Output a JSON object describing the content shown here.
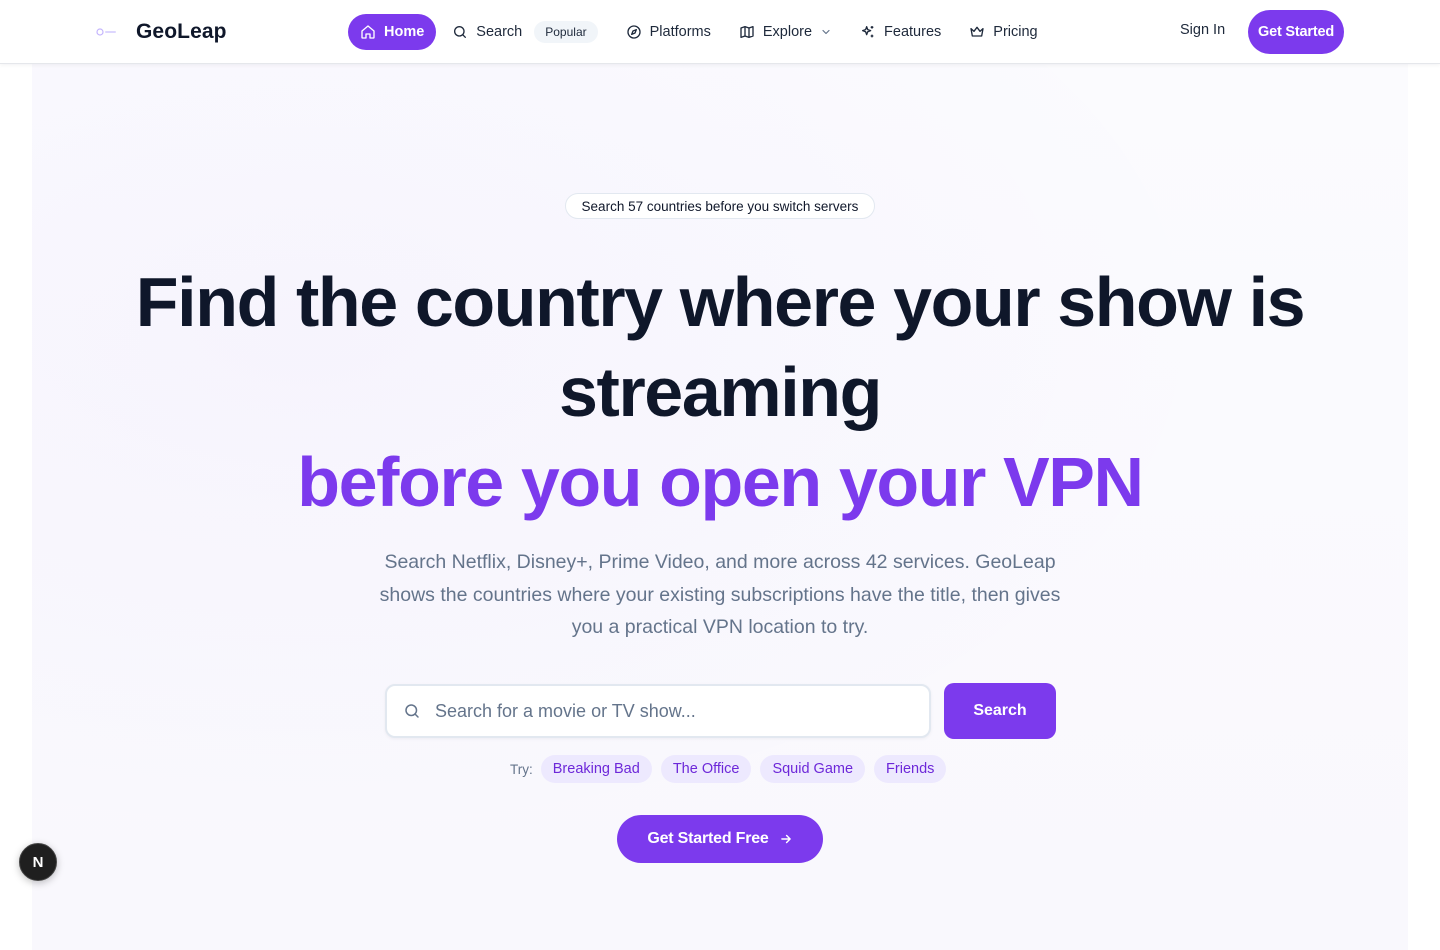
{
  "brand": {
    "name": "GeoLeap",
    "accent": "#7c3aed"
  },
  "nav": {
    "items": [
      {
        "label": "Home",
        "icon": "home-icon",
        "active": true
      },
      {
        "label": "Search",
        "icon": "search-icon",
        "badge": "Popular"
      },
      {
        "label": "Platforms",
        "icon": "compass-icon"
      },
      {
        "label": "Explore",
        "icon": "map-icon",
        "dropdown": true
      },
      {
        "label": "Features",
        "icon": "sparkles-icon"
      },
      {
        "label": "Pricing",
        "icon": "crown-icon"
      }
    ],
    "sign_in": "Sign In",
    "get_started": "Get Started"
  },
  "hero": {
    "pill": "Search 57 countries before you switch servers",
    "headline_line1": "Find the country where your show is",
    "headline_line2": "streaming",
    "headline_accent": "before you open your VPN",
    "lead": "Search Netflix, Disney+, Prime Video, and more across 42 services. GeoLeap shows the countries where your existing subscriptions have the title, then gives you a practical VPN location to try.",
    "search_placeholder": "Search for a movie or TV show...",
    "search_value": "",
    "search_button": "Search",
    "try_label": "Try:",
    "suggestions": [
      "Breaking Bad",
      "The Office",
      "Squid Game",
      "Friends"
    ],
    "cta": "Get Started Free"
  },
  "dev_badge": "N"
}
